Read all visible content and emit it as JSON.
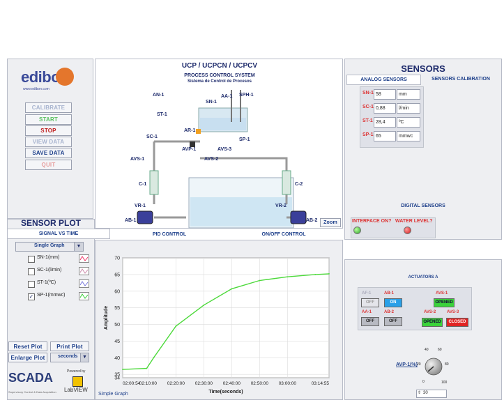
{
  "brand": {
    "logo": "edibon",
    "url": "www.edibon.com"
  },
  "menu": {
    "calibrate": "CALIBRATE",
    "start": "START",
    "stop": "STOP",
    "view_data": "VIEW DATA",
    "save_data": "SAVE DATA",
    "quit": "QUIT"
  },
  "diagram": {
    "title": "UCP / UCPCN / UCPCV",
    "subtitle": "PROCESS CONTROL SYSTEM",
    "subtitle2": "Sistema de Control de Procesos",
    "labels": {
      "an1": "AN-1",
      "aa1": "AA-1",
      "sph1": "SPH-1",
      "sn1": "SN-1",
      "st1": "ST-1",
      "ar1": "AR-1",
      "sc1": "SC-1",
      "avp1": "AVP-1",
      "avs3": "AVS-3",
      "sp1": "SP-1",
      "avs1": "AVS-1",
      "avs2": "AVS-2",
      "c1": "C-1",
      "c2": "C-2",
      "vr1": "VR-1",
      "vr2": "VR-2",
      "ab1": "AB-1",
      "ab2": "AB-2"
    },
    "zoom": "Zoom"
  },
  "sensors": {
    "title": "SENSORS",
    "tab_analog": "ANALOG SENSORS",
    "tab_calibration": "SENSORS CALIBRATION",
    "analog": [
      {
        "name": "SN-1",
        "value": "58",
        "unit": "mm"
      },
      {
        "name": "SC-1",
        "value": "0,88",
        "unit": "l/min"
      },
      {
        "name": "ST-1",
        "value": "28,4",
        "unit": "ºC"
      },
      {
        "name": "SP-1",
        "value": "65",
        "unit": "mmwc"
      }
    ],
    "digital_title": "DIGITAL SENSORS",
    "interface_label": "INTERFACE ON?",
    "water_label": "WATER LEVEL?"
  },
  "tabs": {
    "signal_vs_time": "SIGNAL VS TIME",
    "pid_control": "PID CONTROL",
    "onoff_control": "ON/OFF CONTROL"
  },
  "sensor_plot": {
    "title": "SENSOR PLOT",
    "graph_mode": "Single Graph",
    "channels": [
      {
        "label": "SN-1(mm)",
        "checked": false
      },
      {
        "label": "SC-1(l/min)",
        "checked": false
      },
      {
        "label": "ST-1(ºC)",
        "checked": false
      },
      {
        "label": "SP-1(mmwc)",
        "checked": true
      }
    ],
    "reset_plot": "Reset Plot",
    "print_plot": "Print Plot",
    "enlarge_plot": "Enlarge Plot",
    "time_unit": "seconds",
    "footer_label": "Simple Graph"
  },
  "actuators": {
    "title": "ACTUATORS A",
    "ab1_off_label": "AB-1",
    "ab1_on_label": "AB-1",
    "aa1_label": "AA-1",
    "ab2_label": "AB-2",
    "avs1_label": "AVS-1",
    "avs2_label": "AVS-2",
    "avs3_label": "AVS-3",
    "af1_label": "AF-1",
    "btn_off": "OFF",
    "btn_on": "ON",
    "btn_opened": "OPENED",
    "btn_closed": "CLOSED",
    "avp_label": "AVP-1(%)",
    "knob_ticks": [
      "0",
      "20",
      "40",
      "60",
      "80",
      "100"
    ],
    "knob_value": "30"
  },
  "footer": {
    "scada": "SCADA",
    "scada_sub": "Supervisory Control & Data Acquisition",
    "powered_by": "Powered by",
    "labview": "LabVIEW"
  },
  "chart_data": {
    "type": "line",
    "title": "",
    "xlabel": "Time(seconds)",
    "ylabel": "Amplitude",
    "ylim": [
      34,
      70
    ],
    "y_ticks": [
      "34",
      "35",
      "40",
      "45",
      "50",
      "55",
      "60",
      "65",
      "70"
    ],
    "x_ticks": [
      "02:00:54",
      "02:10:00",
      "02:20:00",
      "02:30:00",
      "02:40:00",
      "02:50:00",
      "03:00:00",
      "03:14:55"
    ],
    "grid": true,
    "series": [
      {
        "color": "#4cd93a",
        "x": [
          "02:00:54",
          "02:09:30",
          "02:12:00",
          "02:20:00",
          "02:30:00",
          "02:40:00",
          "02:50:00",
          "03:00:00",
          "03:10:00",
          "03:14:55"
        ],
        "values": [
          36.5,
          36.8,
          40,
          49.5,
          55.8,
          60.7,
          63.2,
          64.3,
          65,
          65.2
        ]
      }
    ]
  }
}
